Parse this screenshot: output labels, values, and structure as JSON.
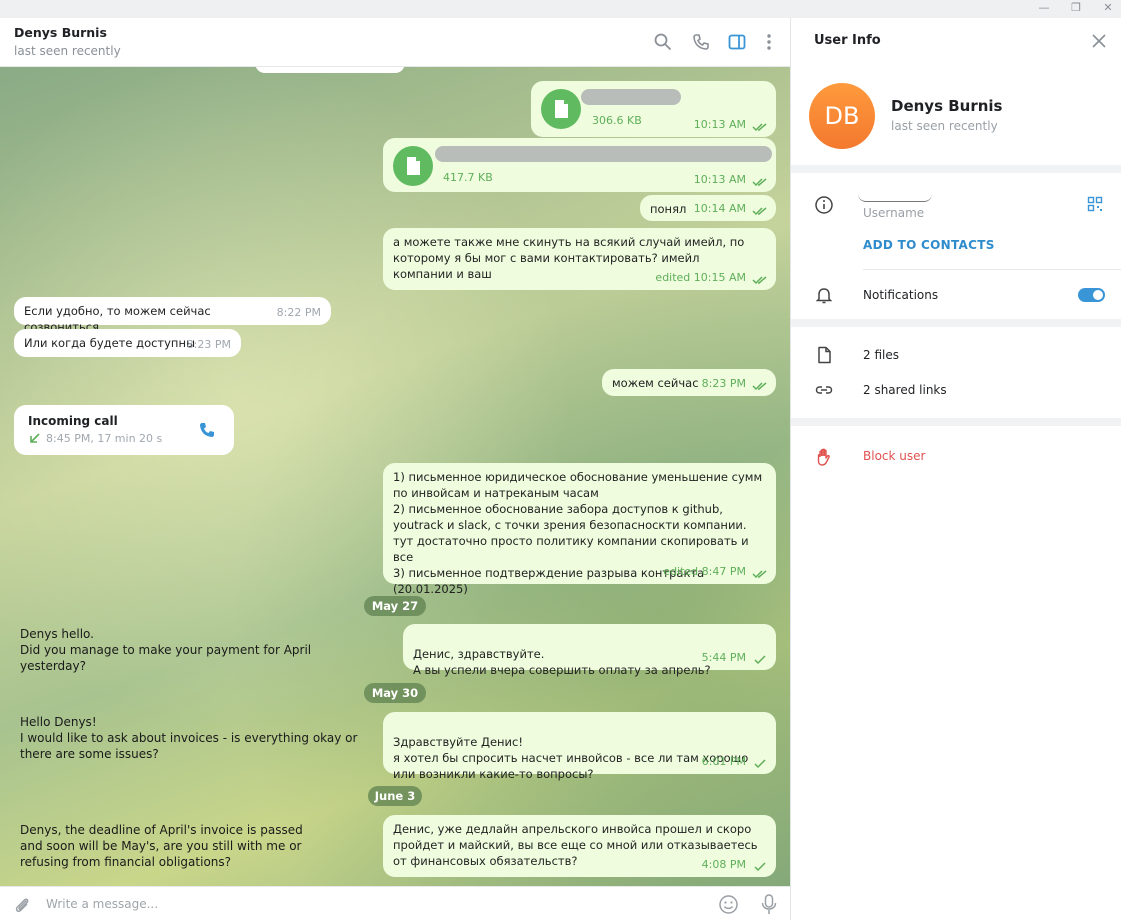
{
  "window": {
    "minimize": "—",
    "restore": "❐",
    "close": "✕"
  },
  "header": {
    "name": "Denys Burnis",
    "status": "last seen recently"
  },
  "messages": {
    "file1_size": "306.6 KB",
    "file1_time": "10:13 AM",
    "file2_size": "417.7 KB",
    "file2_time": "10:13 AM",
    "m_ponyal": "понял",
    "m_ponyal_time": "10:14 AM",
    "m_email": "а можете также мне скинуть на всякий случай имейл, по которому я бы мог с вами контактировать? имейл компании и ваш",
    "m_email_time": "edited 10:15 AM",
    "in_call_now": "Если удобно, то можем сейчас созвониться",
    "in_call_now_time": "8:22 PM",
    "in_when": "Или когда будете доступны",
    "in_when_time": "8:23 PM",
    "m_can_now": "можем сейчас",
    "m_can_now_time": "8:23 PM",
    "call_title": "Incoming call",
    "call_meta": "8:45 PM, 17 min 20 s",
    "m_list_1": "1) письменное юридическое обоснование уменьшение сумм по инвойсам и натреканым часам",
    "m_list_2": "2) письменное обоснование забора доступов к github, youtrack и slack, с точки зрения безопасноскти компании. тут достаточно просто политику компании скопировать и все",
    "m_list_3": "3)  письменное подтверждение разрыва контракта (20.01.2025)",
    "m_list_time": "edited 8:47 PM",
    "date_may27": "May 27",
    "tr_1": "Denys hello.\nDid you manage to make your payment for April yesterday?",
    "m_may27": "Денис, здравствуйте.\nА вы успели вчера совершить оплату за апрель?",
    "m_may27_time": "5:44 PM",
    "date_may30": "May 30",
    "tr_2": "Hello Denys!\nI would like to ask about invoices - is everything okay or there are some issues?",
    "m_may30": "Здравствуйте Денис!\nя хотел бы спросить насчет инвойсов - все ли там хорошо или возникли какие-то вопросы?",
    "m_may30_time": "6:01 PM",
    "date_june3": "June 3",
    "tr_3": "Denys, the deadline of April's invoice is passed and soon will be May's, are you still with me or refusing from financial obligations?",
    "m_june3": "Денис, уже дедлайн апрельского инвойса прошел и скоро пройдет и майский, вы все еще со мной или отказываетесь от финансовых обязательств?",
    "m_june3_time": "4:08 PM"
  },
  "composer": {
    "placeholder": "Write a message..."
  },
  "panel": {
    "title": "User Info",
    "avatar_initials": "DB",
    "name": "Denys Burnis",
    "status": "last seen recently",
    "username_label": "Username",
    "add_contact": "ADD TO CONTACTS",
    "notifications": "Notifications",
    "files": "2 files",
    "links": "2 shared links",
    "block": "Block user"
  },
  "colors": {
    "accent": "#3a95d6",
    "outgoing": "#effdde",
    "danger": "#e0524f",
    "avatar": "#f3792e"
  }
}
